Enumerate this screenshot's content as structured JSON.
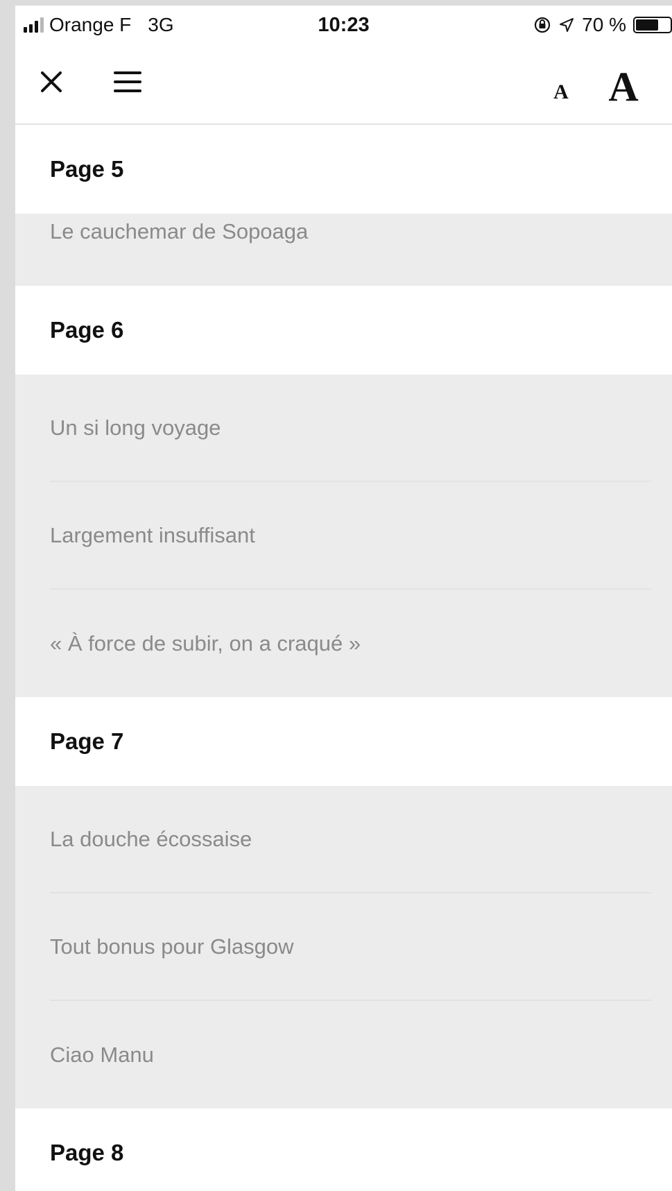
{
  "status_bar": {
    "carrier": "Orange F",
    "network": "3G",
    "time": "10:23",
    "battery_text": "70 %",
    "battery_level": 0.7,
    "icons": [
      "signal-icon",
      "rotation-lock-icon",
      "location-arrow-icon",
      "battery-icon"
    ]
  },
  "toolbar": {
    "close_icon": "close-icon",
    "menu_icon": "menu-icon",
    "font_small_label": "A",
    "font_large_label": "A"
  },
  "toc": [
    {
      "page": "Page 5",
      "articles": [
        "Le cauchemar de Sopoaga"
      ]
    },
    {
      "page": "Page 6",
      "articles": [
        "Un si long voyage",
        "Largement insuffisant",
        "« À force de subir, on a craqué »"
      ]
    },
    {
      "page": "Page 7",
      "articles": [
        "La douche écossaise",
        "Tout bonus pour Glasgow",
        "Ciao Manu"
      ]
    },
    {
      "page": "Page 8",
      "articles": []
    }
  ],
  "colors": {
    "header_bg": "#ffffff",
    "section_bg": "#ececec",
    "article_text": "#8a8a8a",
    "header_text": "#111111"
  }
}
